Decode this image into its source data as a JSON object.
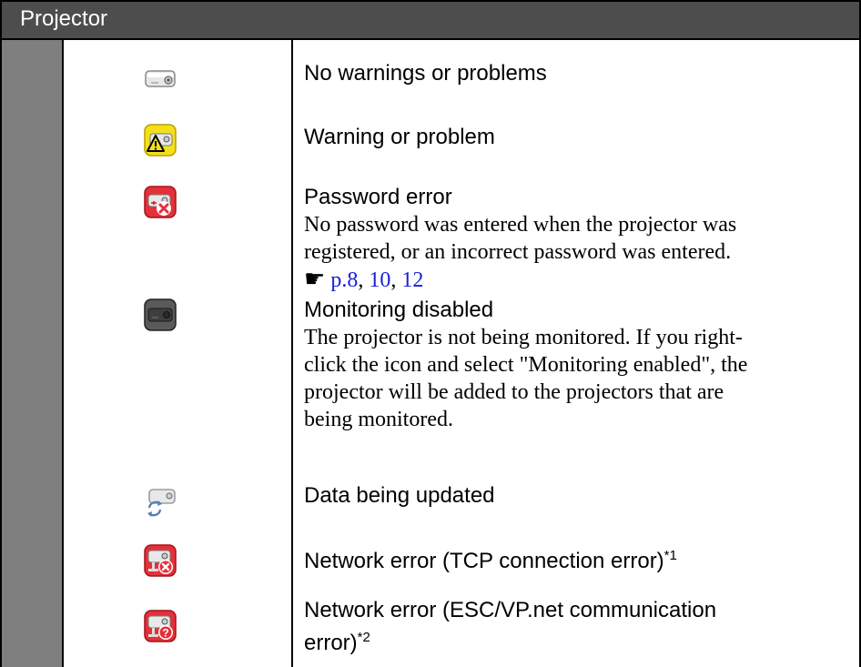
{
  "header": {
    "title": "Projector"
  },
  "rows": [
    {
      "icon": "projector-normal-icon",
      "title": "No warnings or problems"
    },
    {
      "icon": "projector-warning-icon",
      "title": "Warning or problem"
    },
    {
      "icon": "projector-password-error-icon",
      "title": "Password error",
      "description_lines": [
        "No password was entered when the projector was",
        "registered, or an incorrect password was entered."
      ],
      "ref_symbol": "☛",
      "refs": [
        "p.8",
        "10",
        "12"
      ]
    },
    {
      "icon": "projector-monitoring-disabled-icon",
      "title": "Monitoring disabled",
      "description_lines": [
        "The projector is not being monitored. If you right-",
        "click the icon and select \"Monitoring enabled\", the",
        "projector will be added to the projectors that are",
        "being monitored."
      ]
    },
    {
      "icon": "projector-updating-icon",
      "title": "Data being updated"
    },
    {
      "icon": "network-tcp-error-icon",
      "title": "Network error (TCP connection error)",
      "footnote": "*1"
    },
    {
      "icon": "network-escvp-error-icon",
      "title_lines": [
        "Network error (ESC/VP.net communication",
        "error)"
      ],
      "footnote": "*2"
    }
  ]
}
